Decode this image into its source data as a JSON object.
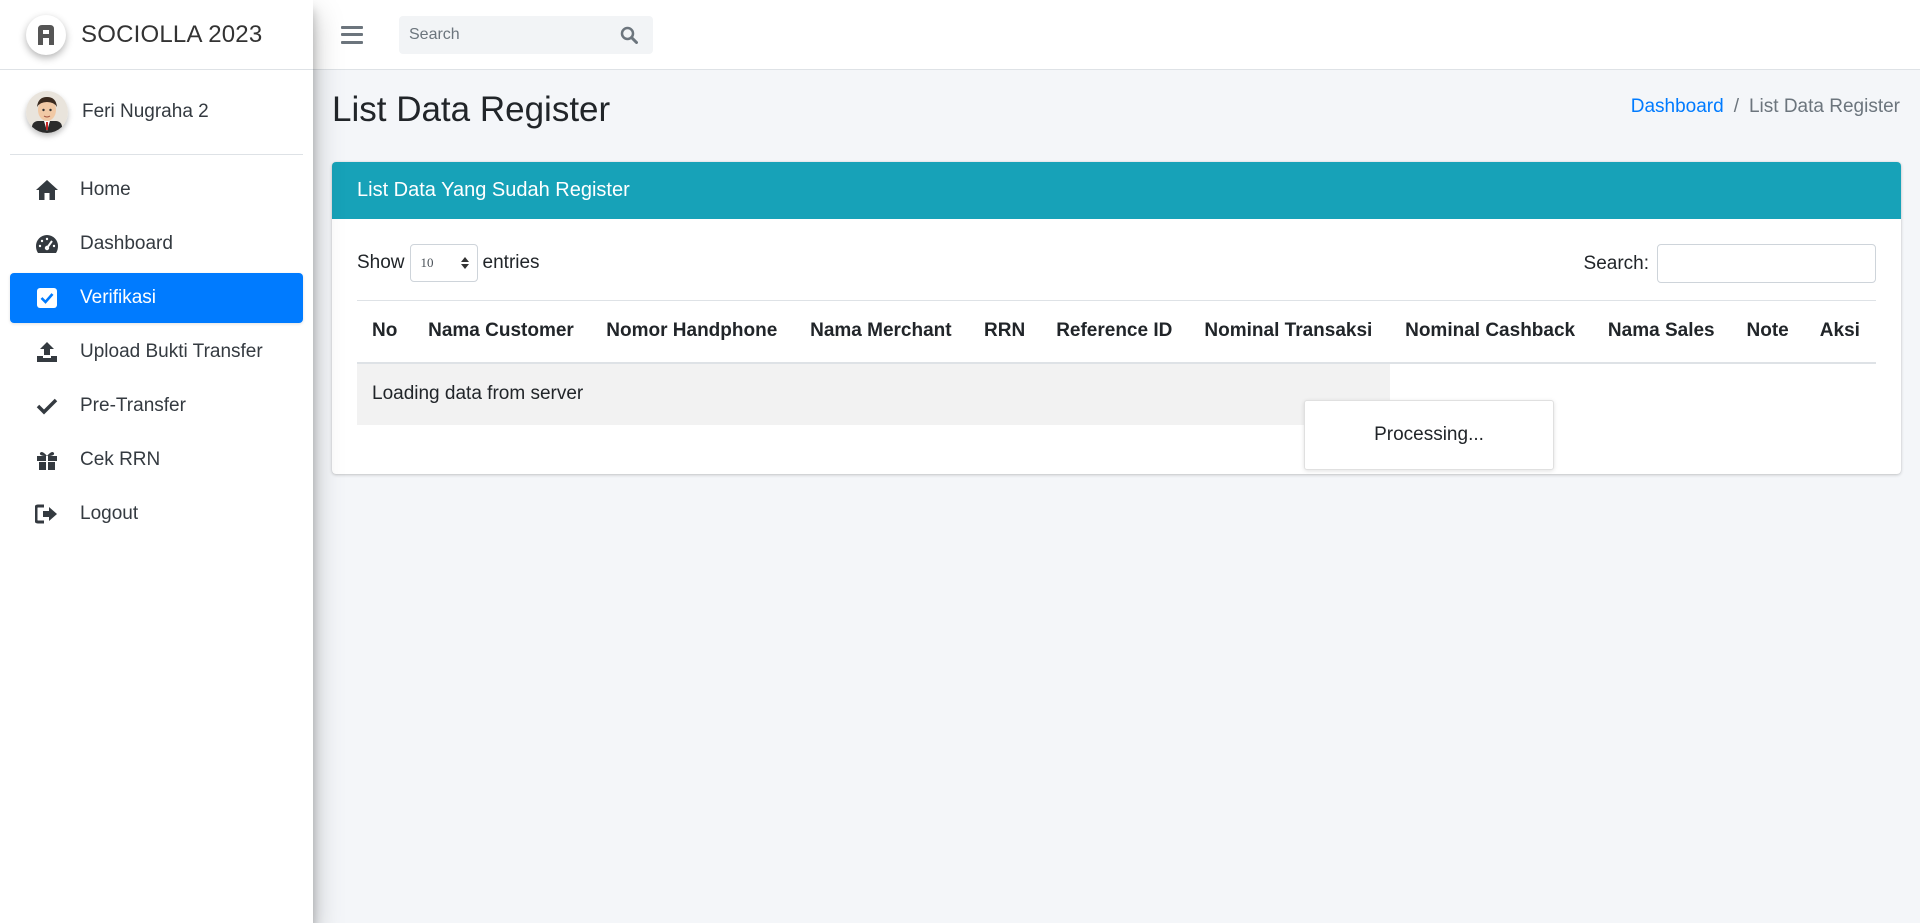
{
  "brand": {
    "name": "SOCIOLLA 2023"
  },
  "user": {
    "name": "Feri Nugraha 2"
  },
  "sidebar": {
    "items": [
      {
        "label": "Home",
        "icon": "home-icon"
      },
      {
        "label": "Dashboard",
        "icon": "gauge-icon"
      },
      {
        "label": "Verifikasi",
        "icon": "check-square-icon",
        "active": true
      },
      {
        "label": "Upload Bukti Transfer",
        "icon": "upload-icon"
      },
      {
        "label": "Pre-Transfer",
        "icon": "check-icon"
      },
      {
        "label": "Cek RRN",
        "icon": "gift-icon"
      },
      {
        "label": "Logout",
        "icon": "sign-out-icon"
      }
    ]
  },
  "topbar": {
    "search_placeholder": "Search"
  },
  "page": {
    "title": "List Data Register",
    "breadcrumb": {
      "link": "Dashboard",
      "separator": "/",
      "current": "List Data Register"
    }
  },
  "card": {
    "title": "List Data Yang Sudah Register",
    "length": {
      "prefix": "Show",
      "value": "10",
      "suffix": "entries"
    },
    "filter_label": "Search:",
    "columns": [
      "No",
      "Nama Customer",
      "Nomor Handphone",
      "Nama Merchant",
      "RRN",
      "Reference ID",
      "Nominal Transaksi",
      "Nominal Cashback",
      "Nama Sales",
      "Note",
      "Aksi"
    ],
    "empty_message": "Loading data from server",
    "processing": "Processing..."
  },
  "colors": {
    "primary": "#007bff",
    "card_header": "#17a2b8",
    "background": "#f4f6f9"
  }
}
